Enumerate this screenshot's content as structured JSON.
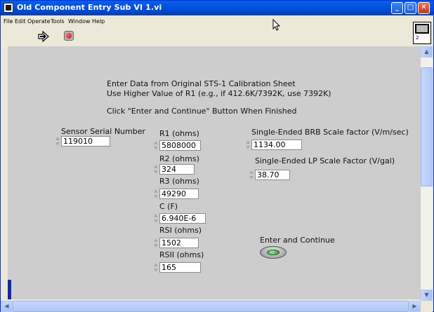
{
  "window": {
    "title": "Old Component Entry Sub VI 1.vi",
    "minimize_glyph": "_",
    "maximize_glyph": "□",
    "close_glyph": "✕"
  },
  "menu": [
    "File",
    "Edit",
    "Operate",
    "Tools",
    "Window",
    "Help"
  ],
  "toolbar": {
    "run_icon": "run-arrow-icon",
    "abort_icon": "abort-stop-icon",
    "vi_icon_number": "2"
  },
  "instructions": {
    "line1": "Enter Data from Original STS-1 Calibration Sheet",
    "line2": "Use Higher Value of R1 (e.g., if 412.6K/7392K, use 7392K)",
    "line3": "Click \"Enter and Continue\" Button When Finished"
  },
  "controls": {
    "sensor_serial": {
      "label": "Sensor Serial Number",
      "value": "119010"
    },
    "r1": {
      "label": "R1 (ohms)",
      "value": "5808000"
    },
    "r2": {
      "label": "R2 (ohms)",
      "value": "324"
    },
    "r3": {
      "label": "R3 (ohms)",
      "value": "49290"
    },
    "c": {
      "label": "C (F)",
      "value": "6.940E-6"
    },
    "rsi": {
      "label": "RSI (ohms)",
      "value": "1502"
    },
    "rsii": {
      "label": "RSII (ohms)",
      "value": "165"
    },
    "brb": {
      "label": "Single-Ended BRB Scale factor (V/m/sec)",
      "value": "1134.00"
    },
    "lp": {
      "label": "Single-Ended LP Scale Factor (V/gal)",
      "value": "38.70"
    }
  },
  "enter_button": {
    "label": "Enter and Continue"
  },
  "colors": {
    "title_bar": "#0054e3",
    "panel_bg": "#cdcdcd",
    "window_bg": "#ece9d8"
  }
}
